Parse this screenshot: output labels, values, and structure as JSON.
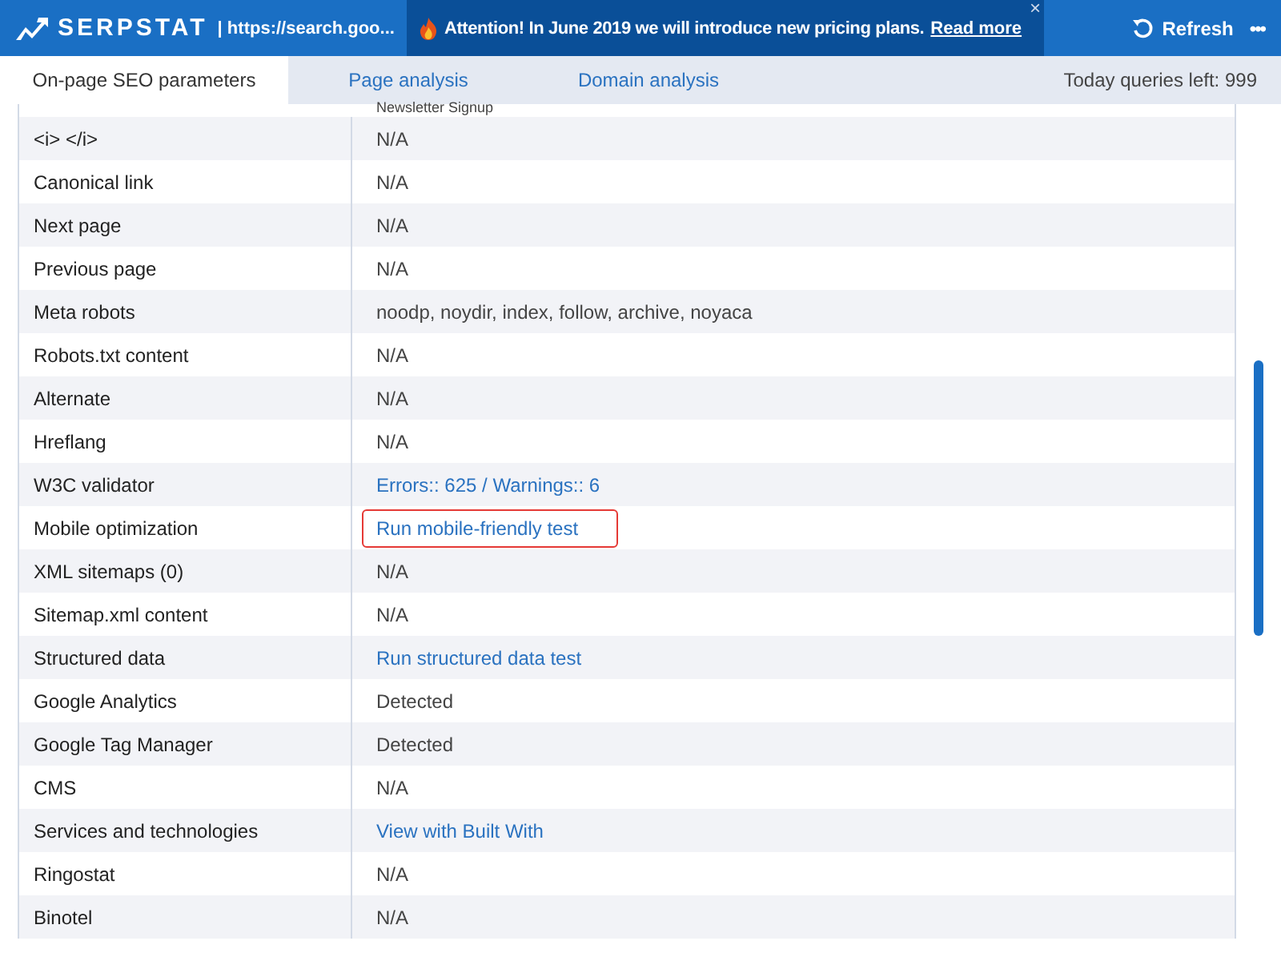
{
  "header": {
    "brand": "SERPSTAT",
    "url": "| https://search.goo...",
    "notice": {
      "text": "Attention! In June 2019 we will introduce new pricing plans.",
      "link": "Read more",
      "close": "×"
    },
    "refresh": "Refresh",
    "more": "•••"
  },
  "tabs": [
    {
      "label": "On-page SEO parameters",
      "selected": true
    },
    {
      "label": "Page analysis",
      "selected": false
    },
    {
      "label": "Domain analysis",
      "selected": false
    }
  ],
  "queries_left": "Today queries left: 999",
  "rows": [
    {
      "name": "",
      "value": "Newsletter Signup",
      "kind": "text",
      "highlighted": false
    },
    {
      "name": "<i> </i>",
      "value": "N/A",
      "kind": "text",
      "highlighted": false
    },
    {
      "name": "Canonical link",
      "value": "N/A",
      "kind": "text",
      "highlighted": false
    },
    {
      "name": "Next page",
      "value": "N/A",
      "kind": "text",
      "highlighted": false
    },
    {
      "name": "Previous page",
      "value": "N/A",
      "kind": "text",
      "highlighted": false
    },
    {
      "name": "Meta robots",
      "value": "noodp, noydir, index, follow, archive, noyaca",
      "kind": "text",
      "highlighted": false
    },
    {
      "name": "Robots.txt content",
      "value": "N/A",
      "kind": "text",
      "highlighted": false
    },
    {
      "name": "Alternate",
      "value": "N/A",
      "kind": "text",
      "highlighted": false
    },
    {
      "name": "Hreflang",
      "value": "N/A",
      "kind": "text",
      "highlighted": false
    },
    {
      "name": "W3C validator",
      "value": "Errors:: 625 / Warnings:: 6",
      "kind": "link",
      "highlighted": false
    },
    {
      "name": "Mobile optimization",
      "value": "Run mobile-friendly test",
      "kind": "link",
      "highlighted": true
    },
    {
      "name": "XML sitemaps (0)",
      "value": "N/A",
      "kind": "text",
      "highlighted": false
    },
    {
      "name": "Sitemap.xml content",
      "value": "N/A",
      "kind": "text",
      "highlighted": false
    },
    {
      "name": "Structured data",
      "value": "Run structured data test",
      "kind": "link",
      "highlighted": false
    },
    {
      "name": "Google Analytics",
      "value": "Detected",
      "kind": "text",
      "highlighted": false
    },
    {
      "name": "Google Tag Manager",
      "value": "Detected",
      "kind": "text",
      "highlighted": false
    },
    {
      "name": "CMS",
      "value": "N/A",
      "kind": "text",
      "highlighted": false
    },
    {
      "name": "Services and technologies",
      "value": "View with Built With",
      "kind": "link",
      "highlighted": false
    },
    {
      "name": "Ringostat",
      "value": "N/A",
      "kind": "text",
      "highlighted": false
    },
    {
      "name": "Binotel",
      "value": "N/A",
      "kind": "text",
      "highlighted": false
    }
  ]
}
